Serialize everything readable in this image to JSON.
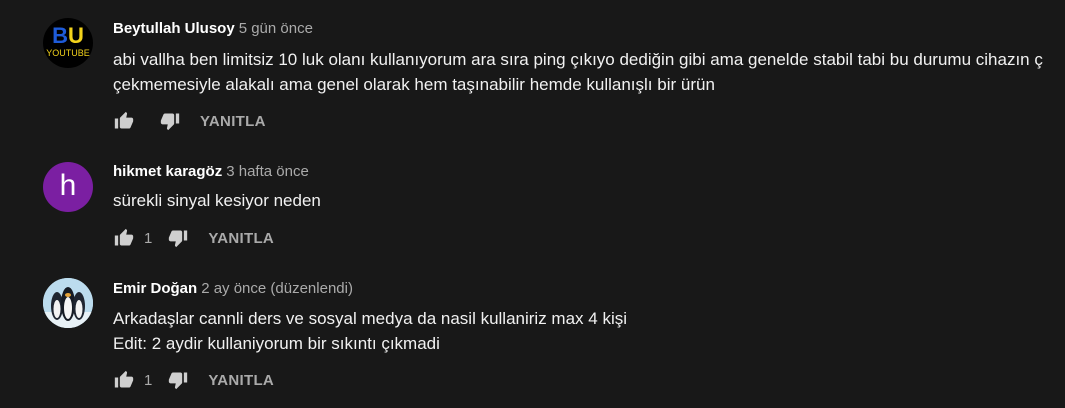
{
  "comments": [
    {
      "author": "Beytullah Ulusoy",
      "time": "5 gün önce",
      "avatar_text": "BU",
      "avatar_subtext": "YOUTUBE",
      "lines": [
        "abi vallha ben limitsiz 10 luk olanı kullanıyorum ara sıra ping çıkıyo  dediğin gibi ama genelde stabil tabi bu durumu cihazın ç",
        "çekmemesiyle alakalı ama genel olarak hem taşınabilir hemde kullanışlı bir ürün"
      ],
      "likes": "",
      "reply_label": "YANITLA"
    },
    {
      "author": "hikmet karagöz",
      "time": "3 hafta önce",
      "avatar_letter": "h",
      "lines": [
        "sürekli sinyal kesiyor neden"
      ],
      "likes": "1",
      "reply_label": "YANITLA"
    },
    {
      "author": "Emir Doğan",
      "time": "2 ay önce (düzenlendi)",
      "lines": [
        "Arkadaşlar cannli ders ve sosyal medya da nasil kullaniriz max 4 kişi",
        "Edit: 2 aydir kullaniyorum bir sıkıntı çıkmadi"
      ],
      "likes": "1",
      "reply_label": "YANITLA"
    }
  ],
  "colors": {
    "background": "#181818",
    "author": "#ffffff",
    "meta": "#aaaaaa",
    "text": "#f1f1f1",
    "avatar_h": "#7b1fa2"
  },
  "icons": {
    "like": "thumb-up-icon",
    "dislike": "thumb-down-icon"
  }
}
